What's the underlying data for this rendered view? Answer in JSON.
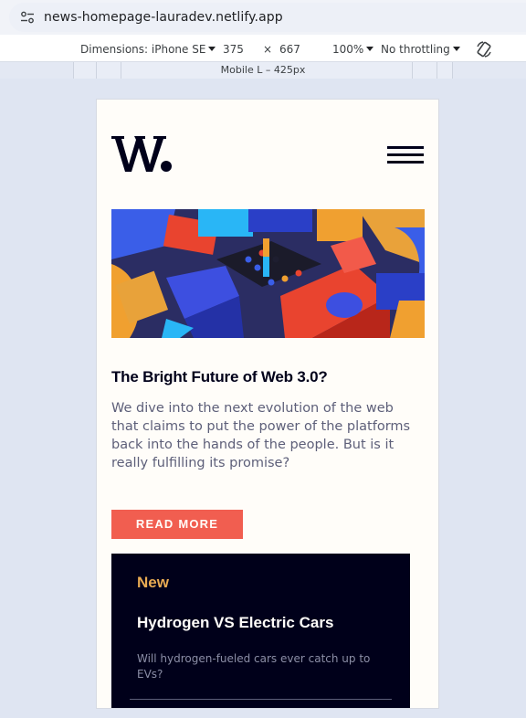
{
  "browser": {
    "url": "news-homepage-lauradev.netlify.app"
  },
  "device_toolbar": {
    "dimensions_label": "Dimensions: iPhone SE",
    "width": "375",
    "times": "×",
    "height": "667",
    "zoom": "100%",
    "throttling": "No throttling"
  },
  "media_query": {
    "label": "Mobile L – 425px"
  },
  "site": {
    "logo_text": "W.",
    "article": {
      "title": "The Bright Future of Web 3.0?",
      "description": "We dive into the next evolution of the web that claims to put the power of the platforms back into the hands of the people. But is it really fulfilling its promise?",
      "button": "READ MORE"
    },
    "new_section": {
      "heading": "New",
      "item_title": "Hydrogen VS Electric Cars",
      "item_description": "Will hydrogen-fueled cars ever catch up to EVs?"
    }
  },
  "colors": {
    "accent": "#f15e50",
    "dark": "#00001a",
    "gold": "#e9ab53",
    "offwhite": "#fffdf9"
  }
}
